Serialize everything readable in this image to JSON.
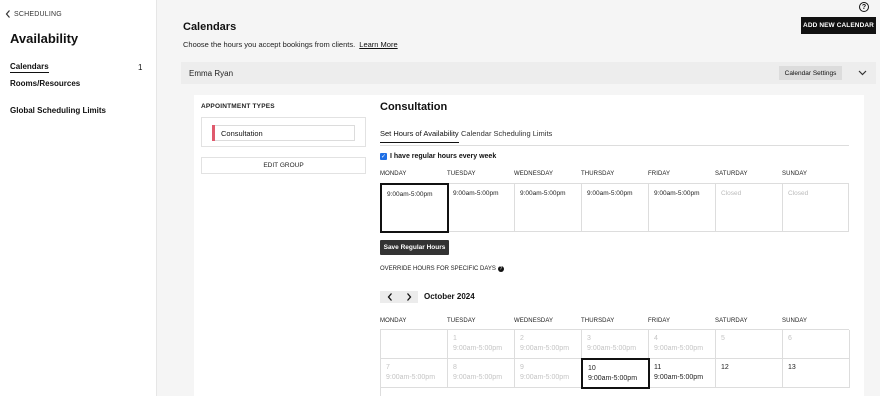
{
  "sidebar": {
    "back_label": "SCHEDULING",
    "title": "Availability",
    "items": [
      {
        "label": "Calendars",
        "count": "1"
      },
      {
        "label": "Rooms/Resources"
      },
      {
        "label": "Global Scheduling Limits"
      }
    ]
  },
  "header": {
    "title": "Calendars",
    "subtitle": "Choose the hours you accept bookings from clients.",
    "learn_more": "Learn More",
    "add_button": "ADD NEW CALENDAR",
    "help_icon": "question-circle-icon"
  },
  "staff": {
    "name": "Emma Ryan",
    "settings_button": "Calendar Settings"
  },
  "appointments": {
    "label": "APPOINTMENT TYPES",
    "items": [
      {
        "name": "Consultation",
        "color": "#e05a6d"
      }
    ],
    "edit_group": "EDIT GROUP"
  },
  "consultation": {
    "title": "Consultation",
    "tabs": [
      "Set Hours of Availability",
      "Calendar Scheduling Limits"
    ],
    "regular_hours_label": "I have regular hours every week",
    "regular_hours_checked": true,
    "days": [
      "MONDAY",
      "TUESDAY",
      "WEDNESDAY",
      "THURSDAY",
      "FRIDAY",
      "SATURDAY",
      "SUNDAY"
    ],
    "hours": [
      "9:00am-5:00pm",
      "9:00am-5:00pm",
      "9:00am-5:00pm",
      "9:00am-5:00pm",
      "9:00am-5:00pm",
      "Closed",
      "Closed"
    ],
    "save_button": "Save Regular Hours",
    "override_label": "OVERRIDE HOURS FOR SPECIFIC DAYS",
    "month": "October 2024",
    "calendar_rows": [
      [
        {
          "day": "",
          "hours": ""
        },
        {
          "day": "1",
          "hours": "9:00am-5:00pm",
          "dim": true
        },
        {
          "day": "2",
          "hours": "9:00am-5:00pm",
          "dim": true
        },
        {
          "day": "3",
          "hours": "9:00am-5:00pm",
          "dim": true
        },
        {
          "day": "4",
          "hours": "9:00am-5:00pm",
          "dim": true
        },
        {
          "day": "5",
          "hours": "",
          "dim": true
        },
        {
          "day": "6",
          "hours": "",
          "dim": true
        }
      ],
      [
        {
          "day": "7",
          "hours": "9:00am-5:00pm",
          "dim": true
        },
        {
          "day": "8",
          "hours": "9:00am-5:00pm",
          "dim": true
        },
        {
          "day": "9",
          "hours": "9:00am-5:00pm",
          "dim": true
        },
        {
          "day": "10",
          "hours": "9:00am-5:00pm",
          "selected": true
        },
        {
          "day": "11",
          "hours": "9:00am-5:00pm"
        },
        {
          "day": "12",
          "hours": ""
        },
        {
          "day": "13",
          "hours": ""
        }
      ]
    ]
  },
  "colors": {
    "accent": "#111111",
    "checkbox": "#1f6fe5",
    "appointment": "#e05a6d"
  }
}
